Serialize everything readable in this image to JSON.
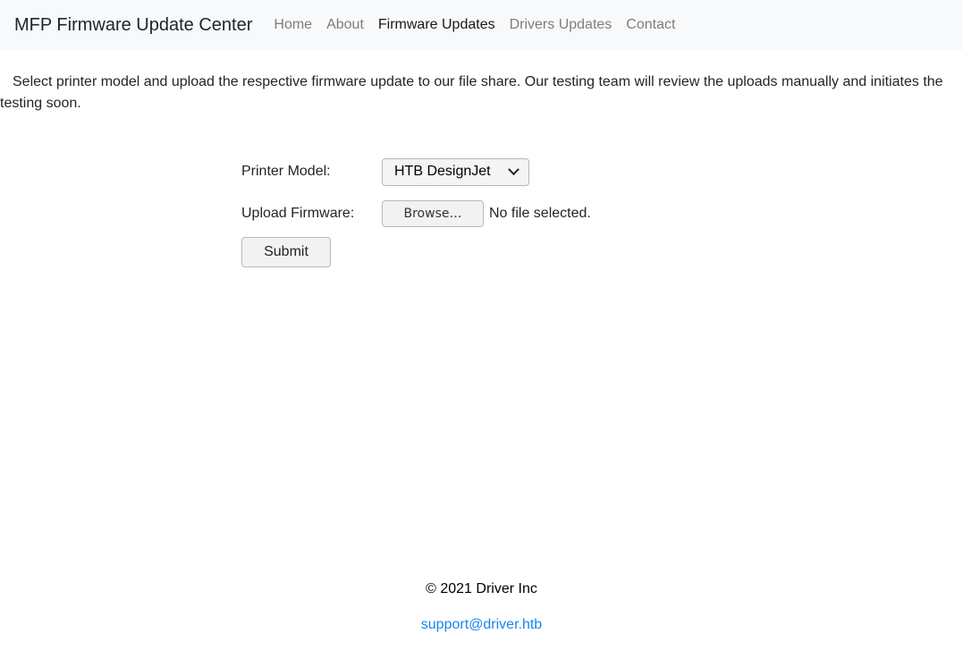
{
  "navbar": {
    "brand": "MFP Firmware Update Center",
    "links": [
      {
        "label": "Home",
        "active": false
      },
      {
        "label": "About",
        "active": false
      },
      {
        "label": "Firmware Updates",
        "active": true
      },
      {
        "label": "Drivers Updates",
        "active": false
      },
      {
        "label": "Contact",
        "active": false
      }
    ]
  },
  "intro": "Select printer model and upload the respective firmware update to our file share. Our testing team will review the uploads manually and initiates the testing soon.",
  "form": {
    "printer_model_label": "Printer Model:",
    "printer_model_value": "HTB DesignJet",
    "upload_label": "Upload Firmware:",
    "browse_label": "Browse…",
    "no_file_text": "No file selected.",
    "submit_label": "Submit"
  },
  "footer": {
    "copyright": "© 2021 Driver Inc",
    "email": "support@driver.htb"
  },
  "colors": {
    "navbar_bg": "#f8f9fa",
    "link": "#1a85ee"
  }
}
